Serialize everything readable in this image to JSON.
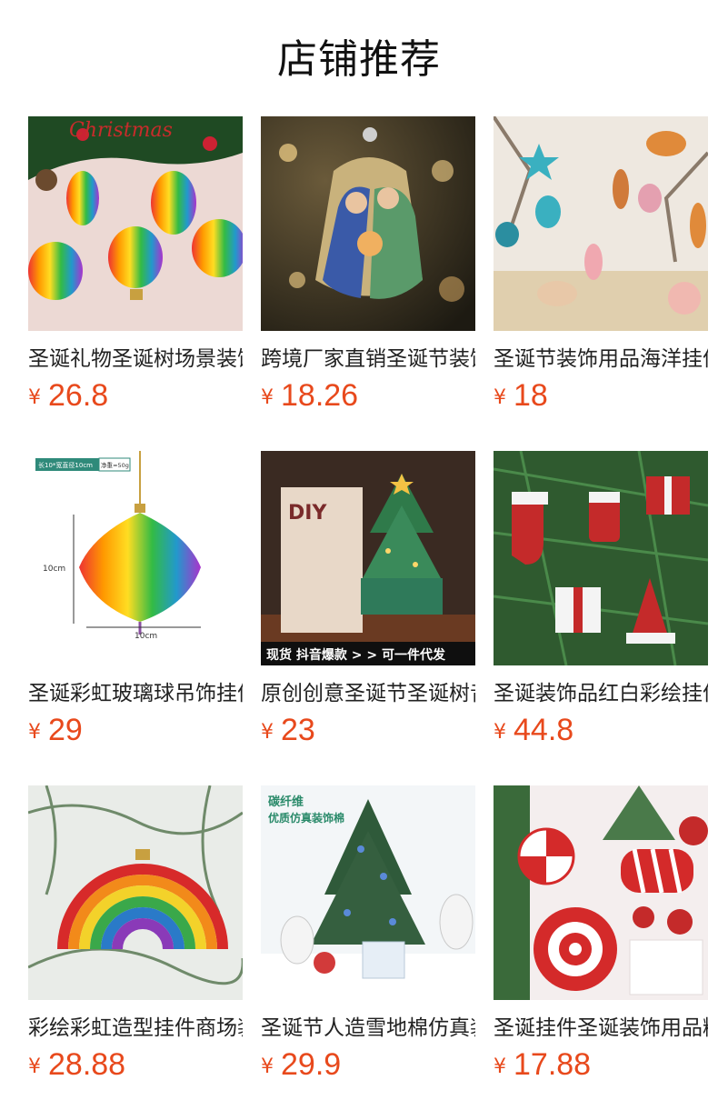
{
  "section_title": "店铺推荐",
  "currency_symbol": "¥",
  "products": [
    {
      "name": "圣诞礼物圣诞树场景装饰",
      "price": "26.8",
      "image": "rainbow-ornaments-photo",
      "image_text": "Christmas"
    },
    {
      "name": "跨境厂家直销圣诞节装饰",
      "price": "18.26",
      "image": "holy-family-glass-ornament-photo"
    },
    {
      "name": "圣诞节装饰用品海洋挂件",
      "price": "18",
      "image": "ocean-theme-ornaments-photo"
    },
    {
      "name": "圣诞彩虹玻璃球吊饰挂件",
      "price": "29",
      "image": "rainbow-onion-ornament-photo",
      "image_text": {
        "tag": "长10*宽直径10cm",
        "weight": "净重≈50g",
        "height_dim": "10cm",
        "width_dim": "10cm"
      }
    },
    {
      "name": "原创创意圣诞节圣诞树音乐盒",
      "price": "23",
      "image": "christmas-tree-music-box-photo",
      "image_text": {
        "banner": "现货 抖音爆款 > > 可一件代发",
        "box": "DIY"
      }
    },
    {
      "name": "圣诞装饰品红白彩绘挂件",
      "price": "44.8",
      "image": "red-white-ornaments-photo"
    },
    {
      "name": "彩绘彩虹造型挂件商场装饰",
      "price": "28.88",
      "image": "rainbow-arch-ornament-photo"
    },
    {
      "name": "圣诞节人造雪地棉仿真装饰",
      "price": "29.9",
      "image": "artificial-snow-tree-scene-photo",
      "image_text": {
        "line1": "碳纤维",
        "line2": "优质仿真装饰棉"
      }
    },
    {
      "name": "圣诞挂件圣诞装饰用品糖果",
      "price": "17.88",
      "image": "candy-ornaments-photo"
    }
  ]
}
